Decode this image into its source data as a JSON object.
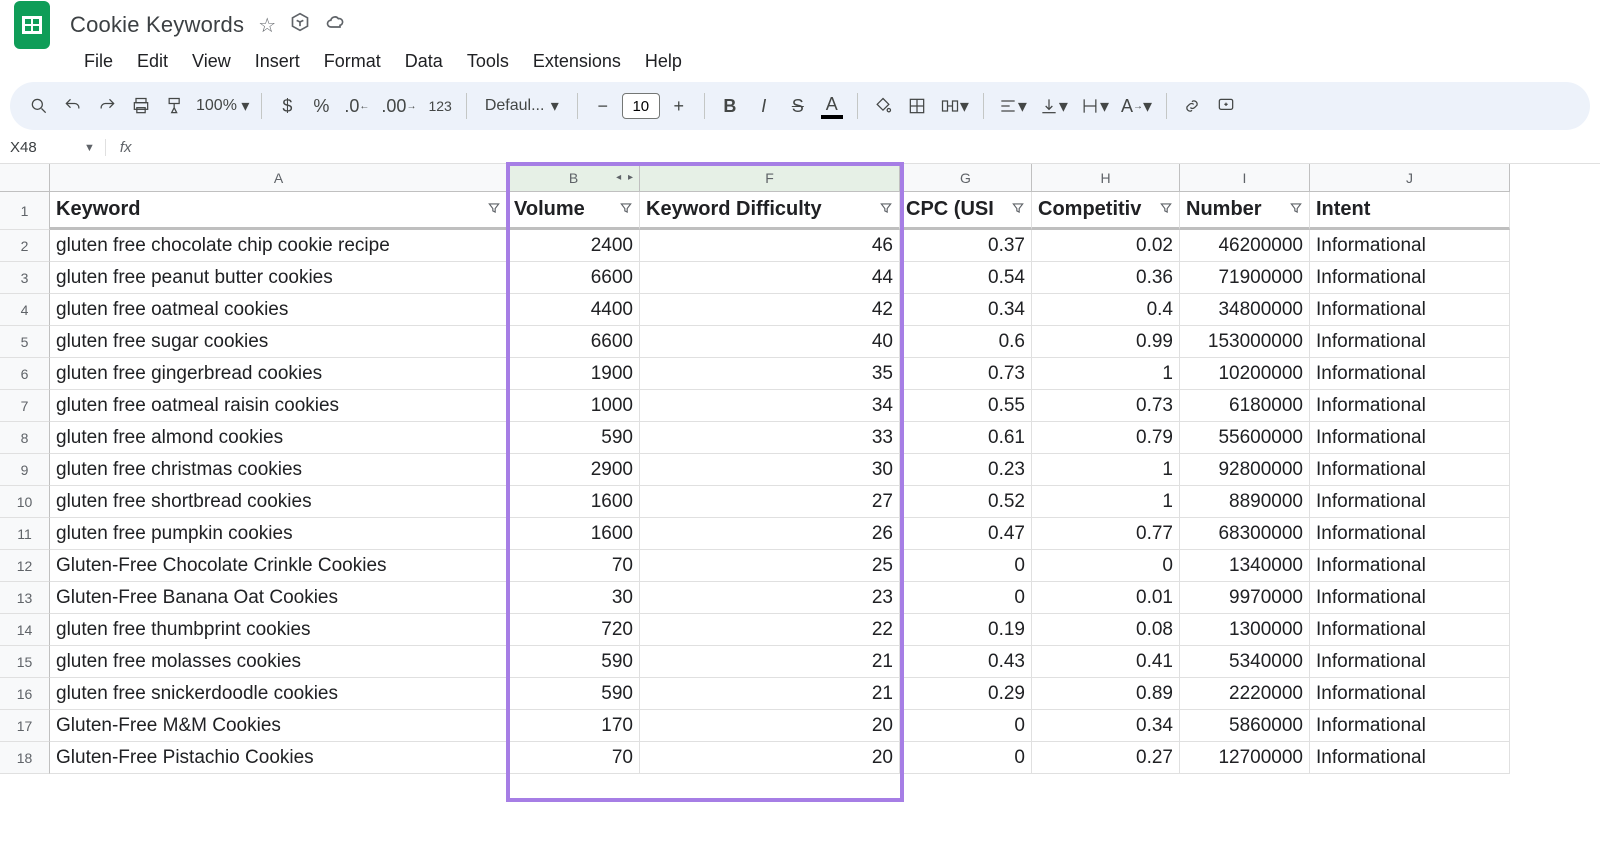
{
  "doc": {
    "title": "Cookie Keywords"
  },
  "menu": [
    "File",
    "Edit",
    "View",
    "Insert",
    "Format",
    "Data",
    "Tools",
    "Extensions",
    "Help"
  ],
  "toolbar": {
    "zoom": "100%",
    "font": "Defaul...",
    "size": "10"
  },
  "nameBox": "X48",
  "columns": [
    "A",
    "B",
    "F",
    "G",
    "H",
    "I",
    "J"
  ],
  "headers": {
    "keyword": "Keyword",
    "volume": "Volume",
    "difficulty": "Keyword Difficulty",
    "cpc": "CPC (USI",
    "comp": "Competitiv",
    "num": "Number",
    "intent": "Intent"
  },
  "rows": [
    {
      "n": 1
    },
    {
      "n": 2,
      "k": "gluten free chocolate chip cookie recipe",
      "v": "2400",
      "d": "46",
      "c": "0.37",
      "m": "0.02",
      "u": "46200000",
      "i": "Informational"
    },
    {
      "n": 3,
      "k": "gluten free peanut butter cookies",
      "v": "6600",
      "d": "44",
      "c": "0.54",
      "m": "0.36",
      "u": "71900000",
      "i": "Informational"
    },
    {
      "n": 4,
      "k": "gluten free oatmeal cookies",
      "v": "4400",
      "d": "42",
      "c": "0.34",
      "m": "0.4",
      "u": "34800000",
      "i": "Informational"
    },
    {
      "n": 5,
      "k": "gluten free sugar cookies",
      "v": "6600",
      "d": "40",
      "c": "0.6",
      "m": "0.99",
      "u": "153000000",
      "i": "Informational"
    },
    {
      "n": 6,
      "k": "gluten free gingerbread cookies",
      "v": "1900",
      "d": "35",
      "c": "0.73",
      "m": "1",
      "u": "10200000",
      "i": "Informational"
    },
    {
      "n": 7,
      "k": "gluten free oatmeal raisin cookies",
      "v": "1000",
      "d": "34",
      "c": "0.55",
      "m": "0.73",
      "u": "6180000",
      "i": "Informational"
    },
    {
      "n": 8,
      "k": "gluten free almond cookies",
      "v": "590",
      "d": "33",
      "c": "0.61",
      "m": "0.79",
      "u": "55600000",
      "i": "Informational"
    },
    {
      "n": 9,
      "k": "gluten free christmas cookies",
      "v": "2900",
      "d": "30",
      "c": "0.23",
      "m": "1",
      "u": "92800000",
      "i": "Informational"
    },
    {
      "n": 10,
      "k": "gluten free shortbread cookies",
      "v": "1600",
      "d": "27",
      "c": "0.52",
      "m": "1",
      "u": "8890000",
      "i": "Informational"
    },
    {
      "n": 11,
      "k": "gluten free pumpkin cookies",
      "v": "1600",
      "d": "26",
      "c": "0.47",
      "m": "0.77",
      "u": "68300000",
      "i": "Informational"
    },
    {
      "n": 12,
      "k": "Gluten-Free Chocolate Crinkle Cookies",
      "v": "70",
      "d": "25",
      "c": "0",
      "m": "0",
      "u": "1340000",
      "i": "Informational"
    },
    {
      "n": 13,
      "k": "Gluten-Free Banana Oat Cookies",
      "v": "30",
      "d": "23",
      "c": "0",
      "m": "0.01",
      "u": "9970000",
      "i": "Informational"
    },
    {
      "n": 14,
      "k": "gluten free thumbprint cookies",
      "v": "720",
      "d": "22",
      "c": "0.19",
      "m": "0.08",
      "u": "1300000",
      "i": "Informational"
    },
    {
      "n": 15,
      "k": "gluten free molasses cookies",
      "v": "590",
      "d": "21",
      "c": "0.43",
      "m": "0.41",
      "u": "5340000",
      "i": "Informational"
    },
    {
      "n": 16,
      "k": "gluten free snickerdoodle cookies",
      "v": "590",
      "d": "21",
      "c": "0.29",
      "m": "0.89",
      "u": "2220000",
      "i": "Informational"
    },
    {
      "n": 17,
      "k": "Gluten-Free M&M Cookies",
      "v": "170",
      "d": "20",
      "c": "0",
      "m": "0.34",
      "u": "5860000",
      "i": "Informational"
    },
    {
      "n": 18,
      "k": "Gluten-Free Pistachio Cookies",
      "v": "70",
      "d": "20",
      "c": "0",
      "m": "0.27",
      "u": "12700000",
      "i": "Informational"
    }
  ]
}
